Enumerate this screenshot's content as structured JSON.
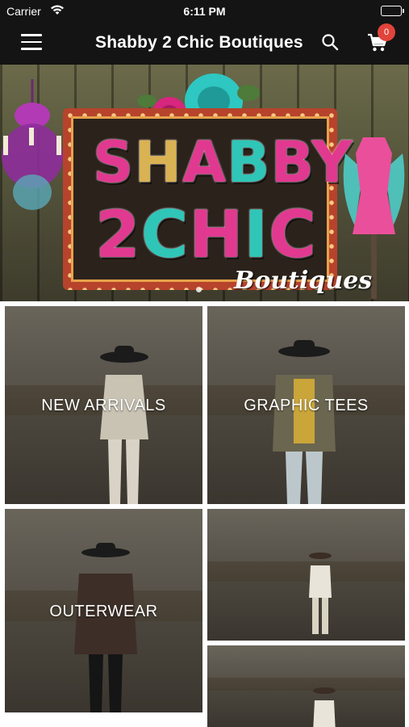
{
  "status_bar": {
    "carrier": "Carrier",
    "time": "6:11 PM",
    "wifi_icon": "wifi-icon",
    "battery_icon": "battery-icon"
  },
  "nav": {
    "menu_icon": "hamburger-menu-icon",
    "title": "Shabby 2 Chic Boutiques",
    "search_icon": "search-icon",
    "cart_icon": "cart-icon",
    "cart_count": "0",
    "badge_color": "#e0443b",
    "bar_color": "#141414"
  },
  "hero": {
    "logo_line1": [
      "S",
      "H",
      "A",
      "B",
      "B",
      "Y"
    ],
    "logo_line2": [
      "2",
      "C",
      "H",
      "I",
      "C"
    ],
    "logo_script": "Boutiques",
    "page_indicator": {
      "current": 1
    }
  },
  "collections": [
    {
      "label": "NEW ARRIVALS"
    },
    {
      "label": "GRAPHIC TEES"
    },
    {
      "label": "OUTERWEAR"
    },
    {
      "label": ""
    },
    {
      "label": ""
    }
  ]
}
